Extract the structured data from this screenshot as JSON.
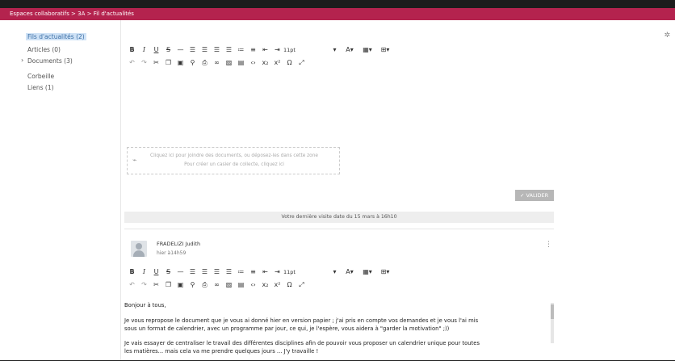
{
  "breadcrumb": "Espaces collaboratifs > 3A > Fil d'actualités",
  "sidebar": {
    "items": [
      {
        "label": "Fils d'actualités (2)"
      },
      {
        "label": "Articles (0)"
      },
      {
        "label": "Documents (3)"
      },
      {
        "label": "Corbeille"
      },
      {
        "label": "Liens (1)"
      }
    ]
  },
  "toolbar": {
    "bold": "B",
    "italic": "I",
    "underline": "U",
    "strike": "S",
    "hr": "—",
    "font_size": "11pt",
    "special_char": "Ω"
  },
  "dropzone": {
    "line1": "Cliquez ici pour joindre des documents, ou déposez-les dans cette zone",
    "line2": "Pour créer un casier de collecte, cliquez ici"
  },
  "valider_label": "VALIDER",
  "last_visit": "Votre dernière visite date du 15 mars à 16h10",
  "post": {
    "author": "FRADELIZI Judith",
    "date": "hier à14h59",
    "lines": [
      "Bonjour à tous,",
      "Je vous repropose le document que je vous ai donné hier en version papier ; j'ai pris en compte vos demandes et je vous l'ai mis",
      "sous un format de calendrier, avec un programme par jour, ce qui, je l'espère, vous aidera à \"garder la motivation\" ;))",
      "Je vais essayer de centraliser le travail des différentes disciplines afin de pouvoir vous proposer un calendrier unique pour toutes",
      "les matières... mais cela va me prendre quelques jours ... J'y travaille !"
    ]
  }
}
